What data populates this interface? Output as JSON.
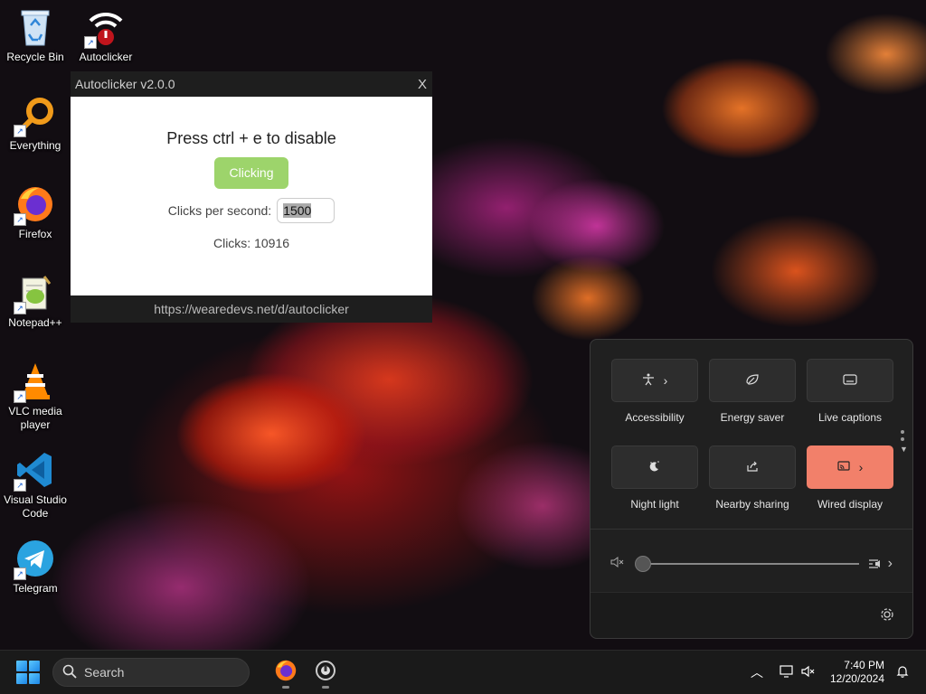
{
  "desktop": {
    "icons": [
      {
        "label": "Recycle Bin",
        "icon": "recycle-bin-icon"
      },
      {
        "label": "Autoclicker",
        "icon": "autoclicker-icon"
      },
      {
        "label": "Everything",
        "icon": "everything-search-icon"
      },
      {
        "label": "Firefox",
        "icon": "firefox-icon"
      },
      {
        "label": "Notepad++",
        "icon": "notepadpp-icon"
      },
      {
        "label": "VLC media player",
        "icon": "vlc-icon"
      },
      {
        "label": "Visual Studio Code",
        "icon": "vscode-icon"
      },
      {
        "label": "Telegram",
        "icon": "telegram-icon"
      }
    ]
  },
  "autoclicker": {
    "title": "Autoclicker v2.0.0",
    "close": "X",
    "heading": "Press ctrl + e to disable",
    "button": "Clicking",
    "cps_label": "Clicks per second:",
    "cps_value": "1500",
    "clicks": "Clicks: 10916",
    "footer": "https://wearedevs.net/d/autoclicker",
    "button_color": "#9dd46b"
  },
  "quick_settings": {
    "tiles": [
      {
        "label": "Accessibility",
        "icon": "accessibility-icon",
        "has_arrow": true,
        "active": false
      },
      {
        "label": "Energy saver",
        "icon": "energy-saver-icon",
        "has_arrow": false,
        "active": false
      },
      {
        "label": "Live captions",
        "icon": "live-captions-icon",
        "has_arrow": false,
        "active": false
      },
      {
        "label": "Night light",
        "icon": "night-light-icon",
        "has_arrow": false,
        "active": false
      },
      {
        "label": "Nearby sharing",
        "icon": "nearby-sharing-icon",
        "has_arrow": false,
        "active": false
      },
      {
        "label": "Wired display",
        "icon": "wired-display-icon",
        "has_arrow": true,
        "active": true
      }
    ],
    "volume_level": 0,
    "muted": true,
    "accent": "#f2806a"
  },
  "taskbar": {
    "search_placeholder": "Search",
    "apps": [
      "firefox-icon",
      "autoclicker-icon"
    ],
    "time": "7:40 PM",
    "date": "12/20/2024"
  }
}
